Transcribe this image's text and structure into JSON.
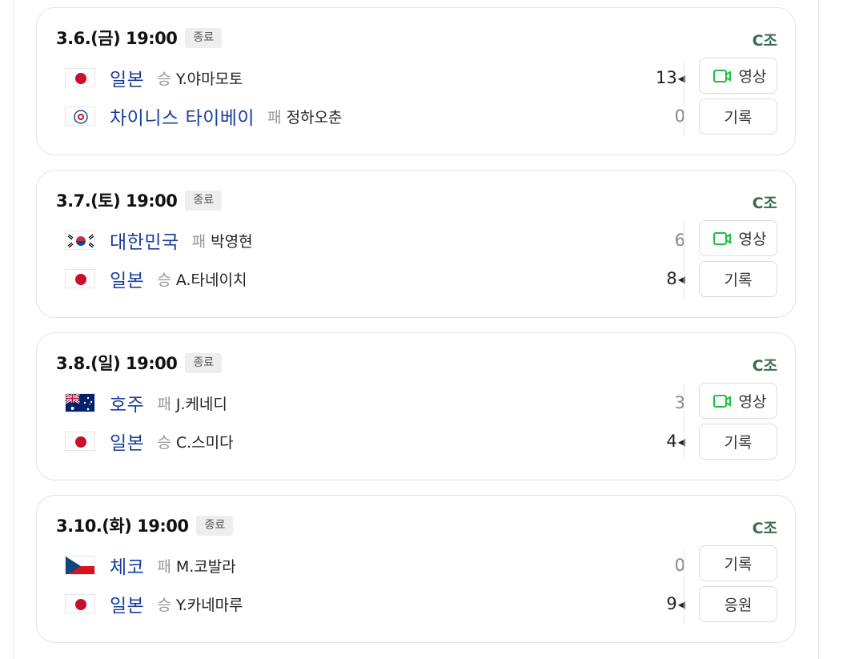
{
  "games": [
    {
      "date": "3.6.(금) 19:00",
      "status": "종료",
      "group": "C조",
      "teams": [
        {
          "flag": "japan",
          "name": "일본",
          "result": "승",
          "pitcher": "Y.야마모토",
          "score": "13",
          "winner": true
        },
        {
          "flag": "chinese-taipei",
          "name": "차이니스 타이베이",
          "result": "패",
          "pitcher": "정하오춘",
          "score": "0",
          "winner": false
        }
      ],
      "buttons": [
        {
          "label": "영상",
          "icon": "video-icon"
        },
        {
          "label": "기록",
          "icon": ""
        }
      ]
    },
    {
      "date": "3.7.(토) 19:00",
      "status": "종료",
      "group": "C조",
      "teams": [
        {
          "flag": "korea",
          "name": "대한민국",
          "result": "패",
          "pitcher": "박영현",
          "score": "6",
          "winner": false
        },
        {
          "flag": "japan",
          "name": "일본",
          "result": "승",
          "pitcher": "A.타네이치",
          "score": "8",
          "winner": true
        }
      ],
      "buttons": [
        {
          "label": "영상",
          "icon": "video-icon"
        },
        {
          "label": "기록",
          "icon": ""
        }
      ]
    },
    {
      "date": "3.8.(일) 19:00",
      "status": "종료",
      "group": "C조",
      "teams": [
        {
          "flag": "australia",
          "name": "호주",
          "result": "패",
          "pitcher": "J.케네디",
          "score": "3",
          "winner": false
        },
        {
          "flag": "japan",
          "name": "일본",
          "result": "승",
          "pitcher": "C.스미다",
          "score": "4",
          "winner": true
        }
      ],
      "buttons": [
        {
          "label": "영상",
          "icon": "video-icon"
        },
        {
          "label": "기록",
          "icon": ""
        }
      ]
    },
    {
      "date": "3.10.(화) 19:00",
      "status": "종료",
      "group": "C조",
      "teams": [
        {
          "flag": "czech",
          "name": "체코",
          "result": "패",
          "pitcher": "M.코발라",
          "score": "0",
          "winner": false
        },
        {
          "flag": "japan",
          "name": "일본",
          "result": "승",
          "pitcher": "Y.카네마루",
          "score": "9",
          "winner": true
        }
      ],
      "buttons": [
        {
          "label": "기록",
          "icon": ""
        },
        {
          "label": "응원",
          "icon": ""
        }
      ]
    }
  ],
  "colors": {
    "team_name": "#1a3e9e",
    "group": "#3c6b4f",
    "video_icon": "#1fbf3f",
    "badge_bg": "#eeeeee"
  }
}
